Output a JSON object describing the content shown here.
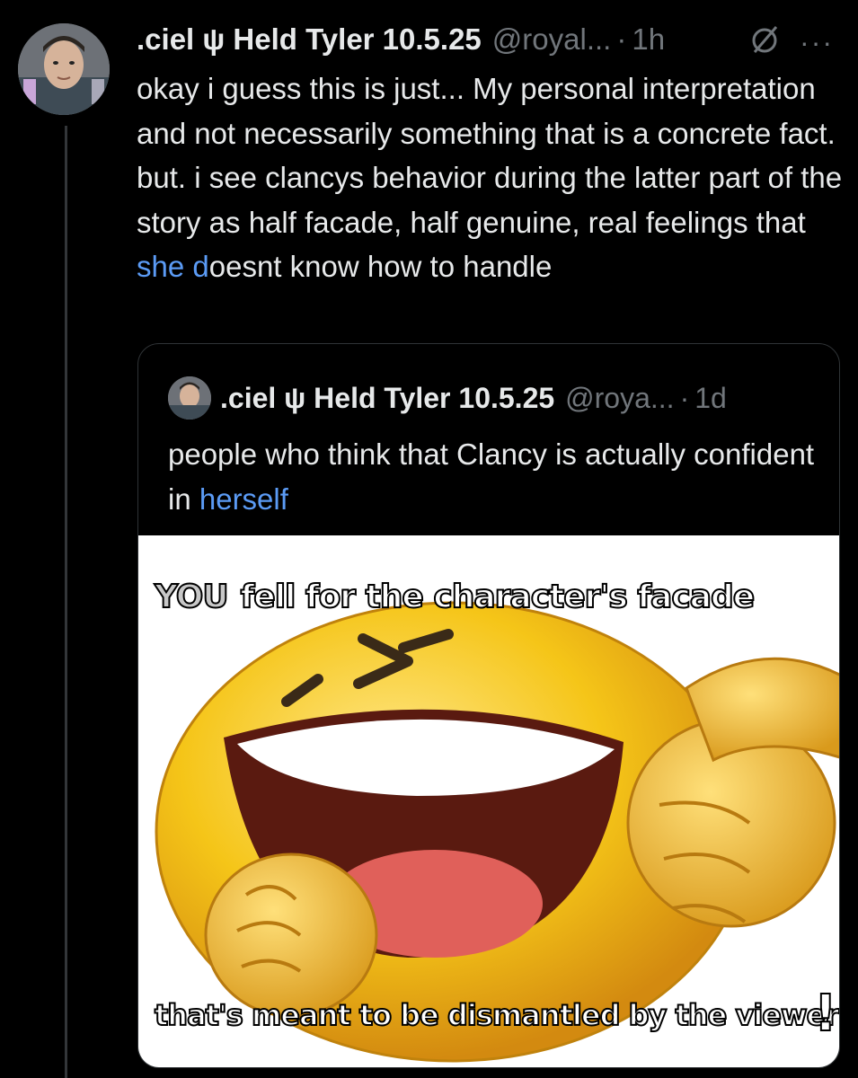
{
  "tweet": {
    "display_name": ".ciel ψ Held Tyler 10.5.25",
    "handle": "@royal...",
    "separator": "·",
    "time": "1h",
    "icon_no_entry": "circle-slash-icon",
    "icon_more": "more-icon",
    "more_glyph": "···",
    "text_before": "okay i guess this is just... My personal interpretation and not necessarily something that is a concrete fact. but. i see clancys behavior during the latter part of the story as half facade, half genuine, real feelings that ",
    "text_highlight": "she d",
    "text_after": "oesnt know how to handle"
  },
  "quoted": {
    "display_name": ".ciel ψ Held Tyler 10.5.25",
    "handle": "@roya...",
    "separator": "·",
    "time": "1d",
    "text_before": "people who think that Clancy is actually confident in ",
    "text_highlight": "herself",
    "meme": {
      "top_caption_you": "YOU",
      "top_caption": "fell for the character's facade",
      "bottom_caption": "that's meant to be dismantled by the viewer",
      "exclamation": "!",
      "accent": "#f5c518"
    }
  },
  "colors": {
    "background": "#000000",
    "text": "#e7e9ea",
    "muted": "#71767b",
    "highlight": "#5b9bf5"
  }
}
